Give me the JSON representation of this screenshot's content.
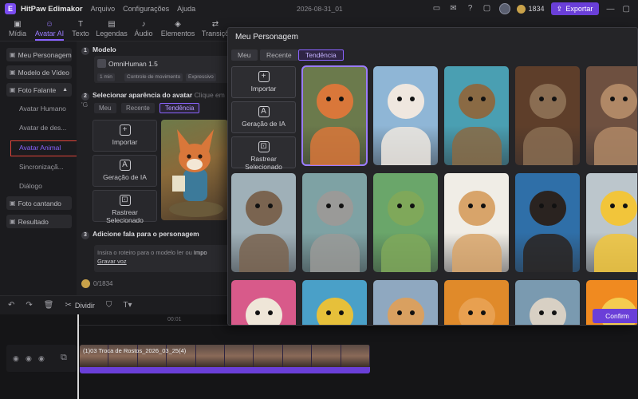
{
  "app": {
    "name": "HitPaw Edimakor",
    "menu": [
      "Arquivo",
      "Configurações",
      "Ajuda"
    ],
    "window_title": "2026-08-31_01",
    "credits": "1834",
    "export_label": "Exportar",
    "accent_color": "#6a3fd8"
  },
  "toolbar": {
    "tabs": [
      {
        "label": "Mídia",
        "icon": "media-icon"
      },
      {
        "label": "Avatar AI",
        "icon": "avatar-ai-icon"
      },
      {
        "label": "Texto",
        "icon": "text-icon"
      },
      {
        "label": "Legendas",
        "icon": "captions-icon"
      },
      {
        "label": "Áudio",
        "icon": "audio-icon"
      },
      {
        "label": "Elementos",
        "icon": "elements-icon"
      },
      {
        "label": "Transiçõ",
        "icon": "transitions-icon"
      }
    ],
    "active_tab": "Avatar AI"
  },
  "sidebar": {
    "items": [
      {
        "label": "Meu Personagem",
        "icon": "user-icon"
      },
      {
        "label": "Modelo de Vídeo",
        "icon": "video-template-icon"
      },
      {
        "label": "Foto Falante",
        "icon": "talking-photo-icon"
      }
    ],
    "subitems": [
      "Avatar Humano",
      "Avatar de des...",
      "Avatar Animal",
      "Sincronizaçã...",
      "Diálogo"
    ],
    "active_subitem": "Avatar Animal",
    "bottom_items": [
      {
        "label": "Foto cantando",
        "icon": "singing-photo-icon"
      },
      {
        "label": "Resultado",
        "icon": "result-icon"
      }
    ]
  },
  "main": {
    "section1_title": "Modelo",
    "model_name": "OmniHuman 1.5",
    "model_chips": [
      "1 min",
      "Controle de movimento",
      "Expressivo"
    ],
    "section2_title": "Selecionar aparência do avatar",
    "section2_hint": "Clique em 'G",
    "segments": [
      "Meu",
      "Recente",
      "Tendência"
    ],
    "active_segment": "Tendência",
    "options": [
      "Importar",
      "Geração de IA",
      "Rastrear Selecionado"
    ],
    "section3_title": "Adicione fala para o personagem",
    "script_placeholder": "Insira o roteiro para o modelo ler ou",
    "script_import": "Impo",
    "script_record": "Gravar voz",
    "char_count": "0/1834"
  },
  "timeline": {
    "tools": [
      "undo-icon",
      "redo-icon",
      "delete-icon"
    ],
    "split_label": "Dividir",
    "ruler_mark": "00:01",
    "clip_label": "(1)03 Troca de Rostos_2026_03_25(4)"
  },
  "modal": {
    "title": "Meu Personagem",
    "segments": [
      "Meu",
      "Recente",
      "Tendência"
    ],
    "active_segment": "Tendência",
    "options": [
      {
        "label": "Importar",
        "icon": "import-icon"
      },
      {
        "label": "Geração de IA",
        "icon": "ai-generate-icon"
      },
      {
        "label": "Rastrear Selecionado",
        "icon": "track-selected-icon"
      }
    ],
    "confirm_label": "Confirm",
    "avatars": [
      {
        "name": "fox",
        "bg": "#6b7a4c",
        "fur": "#d9773a",
        "selected": true
      },
      {
        "name": "white-cat",
        "bg": "#8fb6d6",
        "fur": "#efe7df"
      },
      {
        "name": "owl",
        "bg": "#4a9fb2",
        "fur": "#8a6a44"
      },
      {
        "name": "sloth",
        "bg": "#5e3e2a",
        "fur": "#8a6d52"
      },
      {
        "name": "meerkat",
        "bg": "#6e5040",
        "fur": "#b08866"
      },
      {
        "name": "otter",
        "bg": "#9fb0b8",
        "fur": "#7a6450"
      },
      {
        "name": "koala",
        "bg": "#7ea2a4",
        "fur": "#9a9a98"
      },
      {
        "name": "turtle",
        "bg": "#6aa66a",
        "fur": "#7fa85a"
      },
      {
        "name": "hamster",
        "bg": "#f0ede6",
        "fur": "#d8a46a"
      },
      {
        "name": "dog",
        "bg": "#2f6fa8",
        "fur": "#2a2320"
      },
      {
        "name": "duckling",
        "bg": "#bcc6cc",
        "fur": "#f2c53a"
      },
      {
        "name": "alpaca",
        "bg": "#d85a8a",
        "fur": "#efe6d8"
      },
      {
        "name": "bee",
        "bg": "#4aa0c8",
        "fur": "#e6c03a"
      },
      {
        "name": "cheetah",
        "bg": "#8fa8c0",
        "fur": "#d9a060"
      },
      {
        "name": "cool-cat",
        "bg": "#e08a2a",
        "fur": "#e8a050"
      },
      {
        "name": "goat",
        "bg": "#7a9ab0",
        "fur": "#d8d0c4"
      },
      {
        "name": "chick",
        "bg": "#f08a20",
        "fur": "#f4cc50"
      }
    ]
  }
}
